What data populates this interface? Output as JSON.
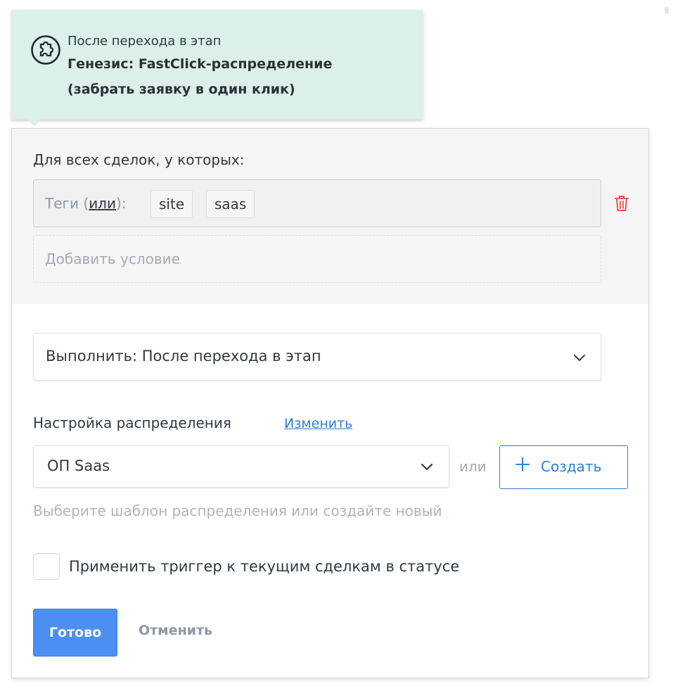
{
  "header": {
    "line1": "После перехода в этап",
    "line2": "Генезис: FastClick-распределение",
    "line3": "(забрать заявку в один клик)",
    "icon": "puzzle-icon",
    "background": "#dcefe8"
  },
  "conditions": {
    "title": "Для всех сделок, у которых:",
    "tags_label_prefix": "Теги (",
    "tags_operator": "или",
    "tags_label_suffix": "):",
    "tags": [
      "site",
      "saas"
    ],
    "delete_icon": "trash-icon",
    "add_condition": "Добавить условие"
  },
  "execute": {
    "value": "Выполнить: После перехода в этап"
  },
  "distribution": {
    "title": "Настройка распределения",
    "change_link": "Изменить",
    "template_value": "ОП Saas",
    "or_label": "или",
    "create_label": "Создать",
    "hint": "Выберите шаблон распределения или создайте новый"
  },
  "apply": {
    "checked": false,
    "label": "Применить триггер к текущим сделкам в статусе"
  },
  "actions": {
    "done": "Готово",
    "cancel": "Отменить"
  },
  "colors": {
    "accent": "#2b7fd6",
    "primary_button": "#4b8ff2",
    "delete": "#e05a4e"
  }
}
